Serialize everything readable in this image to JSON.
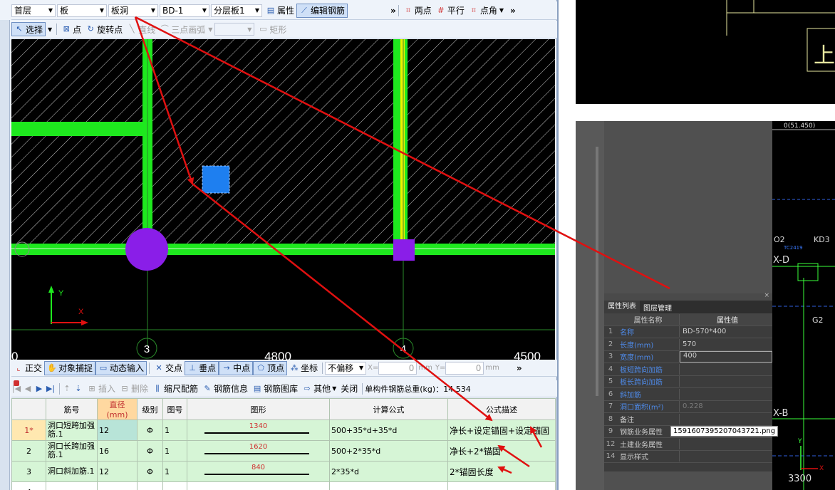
{
  "toolbar1": {
    "floor": "首层",
    "type": "板",
    "subtype": "板洞",
    "element": "BD-1",
    "layer": "分层板1",
    "properties": "属性",
    "edit_rebar": "编辑钢筋",
    "two_points": "两点",
    "parallel": "平行",
    "point_angle": "点角"
  },
  "toolbar2": {
    "select": "选择",
    "point": "点",
    "rotate_point": "旋转点",
    "line": "直线",
    "arc": "三点画弧",
    "rect": "矩形"
  },
  "canvas": {
    "axis_3": "3",
    "axis_4": "4",
    "dim_4800": "4800",
    "dim_4500": "4500",
    "dim_0": "0",
    "y_label": "Y",
    "x_label": "X"
  },
  "toolbar3": {
    "ortho": "正交",
    "snap": "对象捕捉",
    "dyn_input": "动态输入",
    "intersect": "交点",
    "perp": "垂点",
    "mid": "中点",
    "vertex": "顶点",
    "coord": "坐标",
    "offset": "不偏移",
    "x_label": "X=",
    "x_val": "0",
    "y_label": "Y=",
    "y_val": "0",
    "mm": "mm"
  },
  "toolbar4": {
    "insert": "插入",
    "delete": "删除",
    "scale_rebar": "缩尺配筋",
    "rebar_info": "钢筋信息",
    "rebar_lib": "钢筋图库",
    "other": "其他",
    "close": "关闭",
    "total_weight": "单构件钢筋总重(kg)：14.534"
  },
  "table": {
    "headers": [
      "筋号",
      "直径(mm)",
      "级别",
      "图号",
      "图形",
      "计算公式",
      "公式描述"
    ],
    "rows": [
      {
        "idx": "1*",
        "name": "洞口短跨加强筋.1",
        "dia": "12",
        "grade": "Φ",
        "fig": "1",
        "shape": "1340",
        "formula": "500+35*d+35*d",
        "desc": "净长+设定锚固+设定锚固"
      },
      {
        "idx": "2",
        "name": "洞口长跨加强筋.1",
        "dia": "16",
        "grade": "Φ",
        "fig": "1",
        "shape": "1620",
        "formula": "500+2*35*d",
        "desc": "净长+2*锚固"
      },
      {
        "idx": "3",
        "name": "洞口斜加筋.1",
        "dia": "12",
        "grade": "Φ",
        "fig": "1",
        "shape": "840",
        "formula": "2*35*d",
        "desc": "2*锚固长度"
      },
      {
        "idx": "4",
        "name": "",
        "dia": "",
        "grade": "",
        "fig": "",
        "shape": "",
        "formula": "",
        "desc": ""
      }
    ]
  },
  "right_panel": {
    "tab1": "属性列表",
    "tab2": "图层管理",
    "col_name": "属性名称",
    "col_value": "属性值",
    "rows": [
      {
        "n": "1",
        "k": "名称",
        "v": "BD-570*400",
        "blue": true
      },
      {
        "n": "2",
        "k": "长度(mm)",
        "v": "570",
        "blue": true
      },
      {
        "n": "3",
        "k": "宽度(mm)",
        "v": "400",
        "blue": true
      },
      {
        "n": "4",
        "k": "板短跨向加筋",
        "v": "",
        "blue": true
      },
      {
        "n": "5",
        "k": "板长跨向加筋",
        "v": "",
        "blue": true
      },
      {
        "n": "6",
        "k": "斜加筋",
        "v": "",
        "blue": true
      },
      {
        "n": "7",
        "k": "洞口面积(m²)",
        "v": "0.228",
        "blue": true
      },
      {
        "n": "8",
        "k": "备注",
        "v": "",
        "blue": false
      },
      {
        "n": "9",
        "k": "钢筋业务属性",
        "v": "",
        "blue": false
      },
      {
        "n": "12",
        "k": "土建业务属性",
        "v": "",
        "blue": false
      },
      {
        "n": "14",
        "k": "显示样式",
        "v": "",
        "blue": false
      }
    ],
    "tooltip": "1591607395207043721.png",
    "cad_top": "0(51.450)",
    "cad_kd": "KD3",
    "cad_o2": "O2",
    "cad_tc": "TC2419",
    "cad_xd": "X-D",
    "cad_xb": "X-B",
    "cad_g2": "G2",
    "cad_3300": "3300",
    "cad_y": "Y",
    "cad_x": "X"
  },
  "colors": {
    "green": "#1ee81e",
    "yellow": "#f0f000",
    "purple": "#8a1ee8",
    "blue": "#1e7ff0",
    "arrow": "#e01010"
  }
}
